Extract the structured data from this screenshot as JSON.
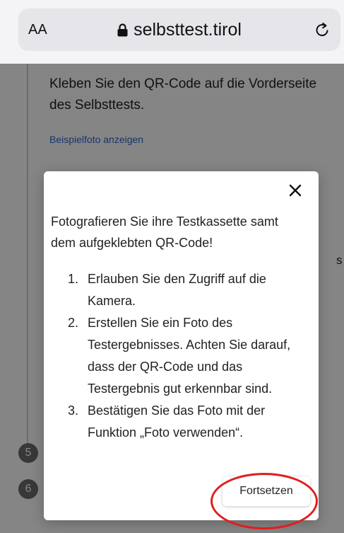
{
  "browser": {
    "text_size_label": "AA",
    "url": "selbsttest.tirol",
    "lock_icon": "lock-icon",
    "reload_icon": "reload-icon"
  },
  "page": {
    "step_text": "Kleben Sie den QR-Code auf die Vorderseite des Selbsttests.",
    "sample_photo_link": "Beispielfoto anzeigen",
    "peek_text": "s",
    "step_numbers": [
      "5",
      "6"
    ]
  },
  "modal": {
    "close_icon": "close-icon",
    "title": "Fotografieren Sie ihre Testkassette samt dem aufgeklebten QR-Code!",
    "steps": [
      {
        "number": "1.",
        "text": "Erlauben Sie den Zugriff auf die Kamera."
      },
      {
        "number": "2.",
        "text": "Erstellen Sie ein Foto des Testergebnisses. Achten Sie darauf, dass der QR-Code und das Testergebnis gut erkennbar sind."
      },
      {
        "number": "3.",
        "text": "Bestätigen Sie das Foto mit der Funktion „Foto verwenden“."
      }
    ],
    "continue_label": "Fortsetzen"
  },
  "colors": {
    "link": "#2a66c7",
    "highlight_ring": "#e01e1e",
    "overlay": "rgba(0,0,0,0.48)"
  }
}
